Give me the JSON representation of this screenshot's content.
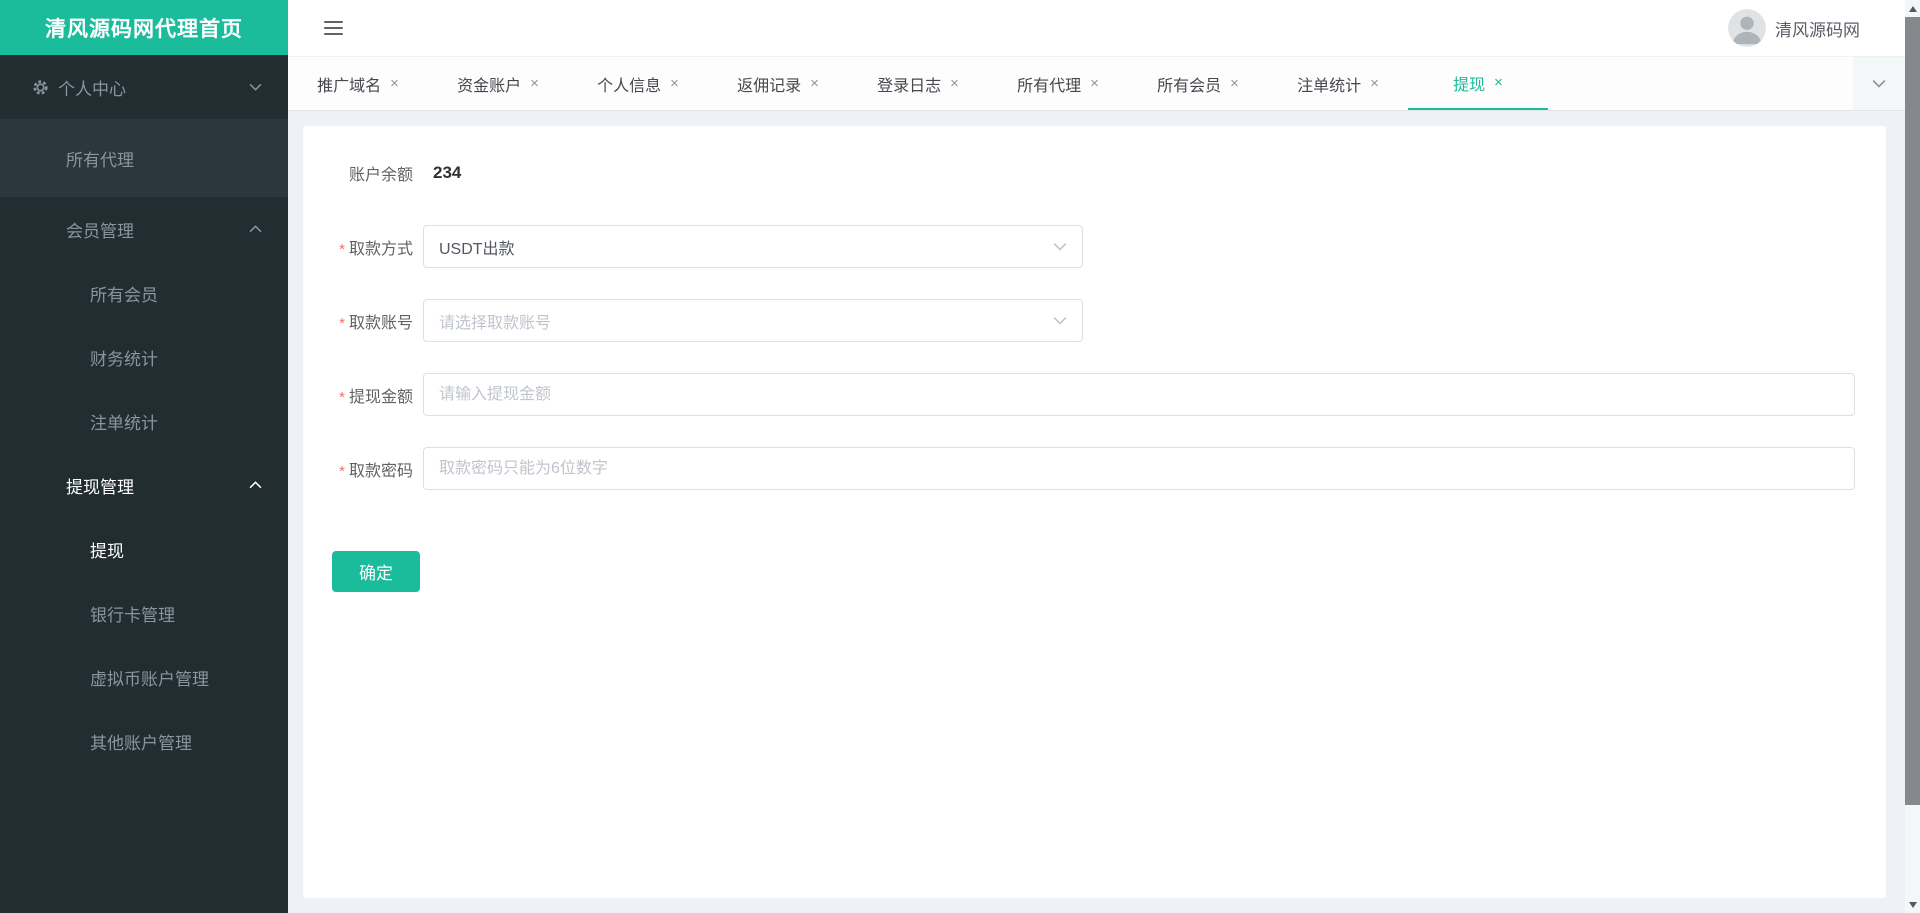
{
  "brand": {
    "title": "清风源码网代理首页"
  },
  "topbar": {
    "username": "清风源码网"
  },
  "icons": {
    "close": "×"
  },
  "sidebar": {
    "items": [
      {
        "name": "personal-center",
        "label": "个人中心",
        "level": 1,
        "icon": "gear",
        "chevron": "down",
        "active": false,
        "band": false
      },
      {
        "name": "all-agents",
        "label": "所有代理",
        "level": 2,
        "active": false,
        "band": true
      },
      {
        "name": "member-mgmt",
        "label": "会员管理",
        "level": 2,
        "chevron": "up",
        "active": false,
        "band": false
      },
      {
        "name": "all-members",
        "label": "所有会员",
        "level": 3,
        "active": false,
        "band": false
      },
      {
        "name": "finance-stats",
        "label": "财务统计",
        "level": 3,
        "active": false,
        "band": false
      },
      {
        "name": "bet-stats",
        "label": "注单统计",
        "level": 3,
        "active": false,
        "band": false
      },
      {
        "name": "withdraw-mgmt",
        "label": "提现管理",
        "level": 2,
        "chevron": "up",
        "active": true,
        "band": false
      },
      {
        "name": "withdraw",
        "label": "提现",
        "level": 3,
        "active": true,
        "band": false
      },
      {
        "name": "bank-card-mgmt",
        "label": "银行卡管理",
        "level": 3,
        "active": false,
        "band": false
      },
      {
        "name": "crypto-account-mgmt",
        "label": "虚拟币账户管理",
        "level": 3,
        "active": false,
        "band": false
      },
      {
        "name": "other-account-mgmt",
        "label": "其他账户管理",
        "level": 3,
        "active": false,
        "band": false
      }
    ]
  },
  "tabs": [
    {
      "name": "promo-domain",
      "label": "推广域名",
      "active": false
    },
    {
      "name": "fund-account",
      "label": "资金账户",
      "active": false
    },
    {
      "name": "personal-info",
      "label": "个人信息",
      "active": false
    },
    {
      "name": "rebate-records",
      "label": "返佣记录",
      "active": false
    },
    {
      "name": "login-logs",
      "label": "登录日志",
      "active": false
    },
    {
      "name": "all-agents",
      "label": "所有代理",
      "active": false
    },
    {
      "name": "all-members",
      "label": "所有会员",
      "active": false
    },
    {
      "name": "bet-stats",
      "label": "注单统计",
      "active": false
    },
    {
      "name": "withdraw",
      "label": "提现",
      "active": true
    }
  ],
  "form": {
    "balance_label": "账户余额",
    "balance_value": "234",
    "fields": [
      {
        "name": "withdraw-method",
        "label": "取款方式",
        "required": true,
        "type": "select",
        "value": "USDT出款"
      },
      {
        "name": "withdraw-account",
        "label": "取款账号",
        "required": true,
        "type": "select",
        "placeholder": "请选择取款账号"
      },
      {
        "name": "withdraw-amount",
        "label": "提现金额",
        "required": true,
        "type": "input",
        "placeholder": "请输入提现金额"
      },
      {
        "name": "withdraw-password",
        "label": "取款密码",
        "required": true,
        "type": "input",
        "placeholder": "取款密码只能为6位数字"
      }
    ],
    "submit_label": "确定"
  },
  "colors": {
    "accent": "#1abc9c",
    "sidebar_bg": "#222d32",
    "sidebar_band_bg": "#2a373d",
    "sidebar_text": "#8a959b",
    "active_text": "#ffffff",
    "tab_text": "#45484d",
    "input_border": "#dcdfe6",
    "placeholder": "#c0c4cc",
    "label_text": "#606266",
    "required": "#f56c6c",
    "content_bg": "#eef1f5"
  }
}
